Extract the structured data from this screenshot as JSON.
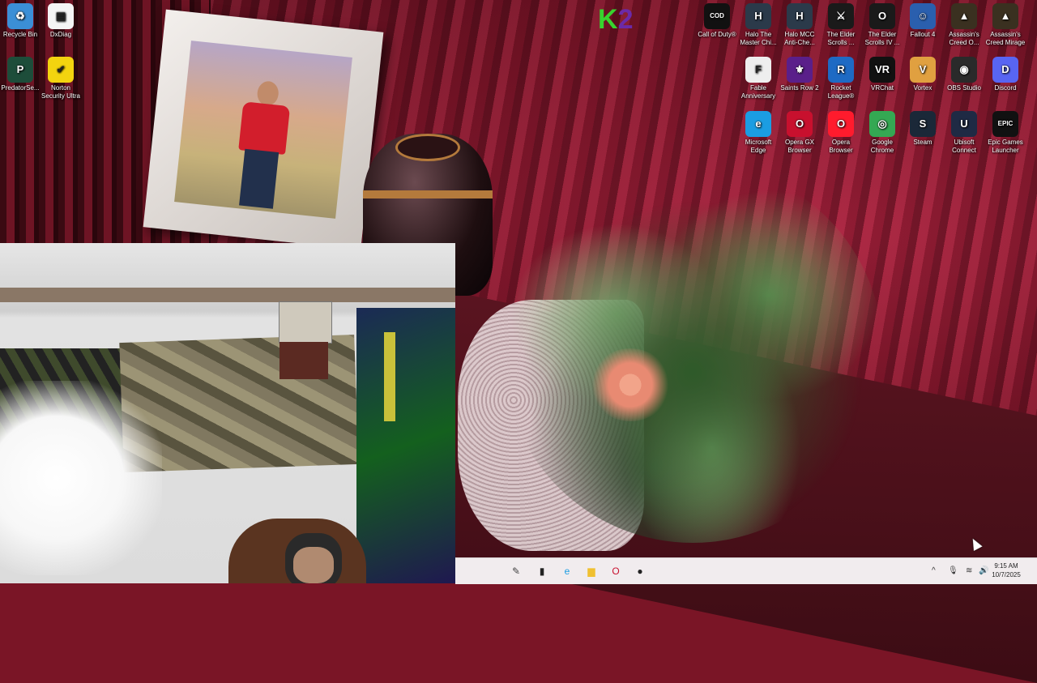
{
  "desktop": {
    "wallpaper_logo": {
      "k": "K",
      "two": "2"
    },
    "icons": [
      {
        "label": "Recycle Bin",
        "icon": "recycle-bin-icon",
        "color": "#3b8fd6",
        "glyph": "♻"
      },
      {
        "label": "DxDiag",
        "icon": "document-icon",
        "color": "#f4f4f4",
        "glyph": "▤"
      },
      {
        "label": "PredatorSe...",
        "icon": "predator-icon",
        "color": "#1d4d3a",
        "glyph": "P"
      },
      {
        "label": "Norton Security Ultra",
        "icon": "norton-icon",
        "color": "#f3d40f",
        "glyph": "✔"
      },
      {
        "label": "Call of Duty®",
        "icon": "call-of-duty-icon",
        "color": "#111111",
        "glyph": "COD"
      },
      {
        "label": "Halo The Master Chi...",
        "icon": "halo-mcc-icon",
        "color": "#2b3a4a",
        "glyph": "H"
      },
      {
        "label": "Halo MCC Anti-Che...",
        "icon": "halo-anticheat-icon",
        "color": "#2b3a4a",
        "glyph": "H"
      },
      {
        "label": "The Elder Scrolls ...",
        "icon": "elder-scrolls-icon",
        "color": "#1a1a1a",
        "glyph": "⚔"
      },
      {
        "label": "The Elder Scrolls IV ...",
        "icon": "oblivion-icon",
        "color": "#1a1a1a",
        "glyph": "O"
      },
      {
        "label": "Fallout 4",
        "icon": "fallout-icon",
        "color": "#2a5fae",
        "glyph": "☺"
      },
      {
        "label": "Assassin's Creed O...",
        "icon": "assassins-creed-odyssey-icon",
        "color": "#3a3020",
        "glyph": "▲"
      },
      {
        "label": "Assassin's Creed Mirage",
        "icon": "assassins-creed-mirage-icon",
        "color": "#3a3020",
        "glyph": "▲"
      },
      {
        "label": "Fable Anniversary",
        "icon": "fable-icon",
        "color": "#eeeeee",
        "glyph": "F"
      },
      {
        "label": "Saints Row 2",
        "icon": "saints-row-icon",
        "color": "#5a1f8a",
        "glyph": "⚜"
      },
      {
        "label": "Rocket League®",
        "icon": "rocket-league-icon",
        "color": "#1e6ac4",
        "glyph": "R"
      },
      {
        "label": "VRChat",
        "icon": "vrchat-icon",
        "color": "#111111",
        "glyph": "VR"
      },
      {
        "label": "Vortex",
        "icon": "vortex-icon",
        "color": "#e0a040",
        "glyph": "V"
      },
      {
        "label": "OBS Studio",
        "icon": "obs-icon",
        "color": "#2a2a2a",
        "glyph": "◉"
      },
      {
        "label": "Discord",
        "icon": "discord-icon",
        "color": "#5865f2",
        "glyph": "D"
      },
      {
        "label": "Microsoft Edge",
        "icon": "edge-icon",
        "color": "#1b9de2",
        "glyph": "e"
      },
      {
        "label": "Opera GX Browser",
        "icon": "opera-gx-icon",
        "color": "#c8102e",
        "glyph": "O"
      },
      {
        "label": "Opera Browser",
        "icon": "opera-icon",
        "color": "#ff1b2d",
        "glyph": "O"
      },
      {
        "label": "Google Chrome",
        "icon": "chrome-icon",
        "color": "#34a853",
        "glyph": "◎"
      },
      {
        "label": "Steam",
        "icon": "steam-icon",
        "color": "#1b2838",
        "glyph": "S"
      },
      {
        "label": "Ubisoft Connect",
        "icon": "ubisoft-icon",
        "color": "#1f2a44",
        "glyph": "U"
      },
      {
        "label": "Epic Games Launcher",
        "icon": "epic-games-icon",
        "color": "#111111",
        "glyph": "EPIC"
      }
    ]
  },
  "taskbar": {
    "buttons": [
      {
        "icon": "pen-icon",
        "glyph": "✎",
        "color": "#444444"
      },
      {
        "icon": "terminal-icon",
        "glyph": "▮",
        "color": "#222222"
      },
      {
        "icon": "edge-icon",
        "glyph": "e",
        "color": "#1b9de2"
      },
      {
        "icon": "file-explorer-icon",
        "glyph": "▆",
        "color": "#f0c030"
      },
      {
        "icon": "opera-gx-icon",
        "glyph": "O",
        "color": "#c8102e"
      },
      {
        "icon": "app-icon",
        "glyph": "●",
        "color": "#222222"
      }
    ],
    "tray": {
      "chevron": "^",
      "mic": "🎙",
      "wifi": "≋",
      "volume": "🔊"
    },
    "clock": {
      "time": "9:15 AM",
      "date": "10/7/2025"
    }
  }
}
